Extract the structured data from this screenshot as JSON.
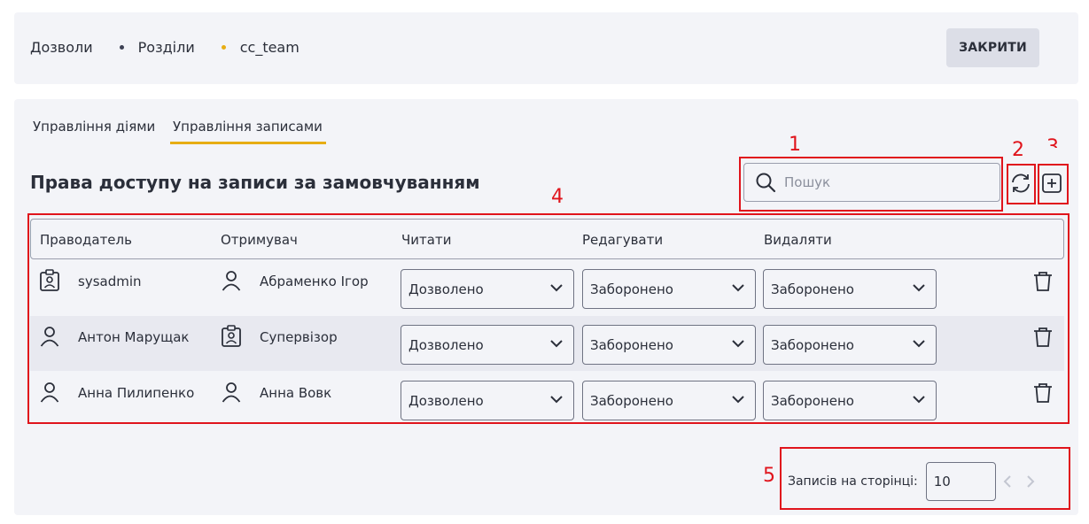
{
  "breadcrumb": {
    "items": [
      "Дозволи",
      "Розділи",
      "cc_team"
    ]
  },
  "header": {
    "close_label": "ЗАКРИТИ"
  },
  "tabs": [
    {
      "label": "Управління діями",
      "active": false
    },
    {
      "label": "Управління записами",
      "active": true
    }
  ],
  "section_title": "Права доступу на записи за замовчуванням",
  "search": {
    "placeholder": "Пошук",
    "value": ""
  },
  "table": {
    "columns": [
      "Праводатель",
      "Отримувач",
      "Читати",
      "Редагувати",
      "Видаляти"
    ],
    "rows": [
      {
        "grantor": "sysadmin",
        "grantor_icon": "role-badge-icon",
        "grantee": "Абраменко Ігор",
        "grantee_icon": "user-icon",
        "read": "Дозволено",
        "edit": "Заборонено",
        "delete": "Заборонено"
      },
      {
        "grantor": "Антон Марущак",
        "grantor_icon": "user-icon",
        "grantee": "Супервізор",
        "grantee_icon": "role-badge-icon",
        "read": "Дозволено",
        "edit": "Заборонено",
        "delete": "Заборонено"
      },
      {
        "grantor": "Анна Пилипенко",
        "grantor_icon": "user-icon",
        "grantee": "Анна Вовк",
        "grantee_icon": "user-icon",
        "read": "Дозволено",
        "edit": "Заборонено",
        "delete": "Заборонено"
      }
    ]
  },
  "pagination": {
    "label": "Записів на сторінці:",
    "page_size": "10"
  },
  "annotations": [
    "1",
    "2",
    "3",
    "4",
    "5"
  ],
  "colors": {
    "accent": "#e7ad14",
    "annotation": "#e0141c",
    "panel": "#f3f4f8"
  },
  "icons": [
    "search-icon",
    "refresh-icon",
    "add-icon",
    "user-icon",
    "role-badge-icon",
    "chevron-down-icon",
    "trash-icon",
    "chevron-left-icon",
    "chevron-right-icon"
  ]
}
